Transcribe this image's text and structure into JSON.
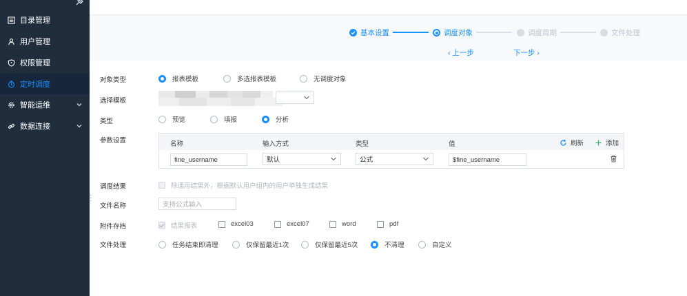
{
  "sidebar": {
    "items": [
      {
        "label": "目录管理",
        "icon": "list-icon"
      },
      {
        "label": "用户管理",
        "icon": "user-icon"
      },
      {
        "label": "权限管理",
        "icon": "shield-icon"
      },
      {
        "label": "定时调度",
        "icon": "clock-icon"
      },
      {
        "label": "智能运维",
        "icon": "gear-icon"
      },
      {
        "label": "数据连接",
        "icon": "link-icon"
      }
    ]
  },
  "steps": [
    {
      "label": "基本设置",
      "state": "done"
    },
    {
      "label": "调度对象",
      "state": "current"
    },
    {
      "label": "调度周期",
      "state": "todo"
    },
    {
      "label": "文件处理",
      "state": "todo"
    }
  ],
  "nav": {
    "prev": "上一步",
    "next": "下一步"
  },
  "form": {
    "object_type": {
      "label": "对象类型",
      "options": [
        "报表模板",
        "多选报表模板",
        "无调度对象"
      ],
      "selected": "报表模板"
    },
    "template": {
      "label": "选择模板"
    },
    "type": {
      "label": "类型",
      "options": [
        "预览",
        "填报",
        "分析"
      ],
      "selected": "分析"
    },
    "params": {
      "label": "参数设置",
      "headers": [
        "名称",
        "输入方式",
        "类型",
        "值"
      ],
      "refresh": "刷新",
      "add": "添加",
      "rows": [
        {
          "name": "fine_username",
          "input_mode": "默认",
          "type": "公式",
          "value": "$fine_username"
        }
      ]
    },
    "result": {
      "label": "调度结果",
      "option": "除通用结果外，根据默认用户组内的用户单独生成结果"
    },
    "filename": {
      "label": "文件名称",
      "placeholder": "支持公式输入"
    },
    "attachment": {
      "label": "附件存档",
      "options": [
        "结果报表",
        "excel03",
        "excel07",
        "word",
        "pdf"
      ],
      "checked": [
        "结果报表"
      ]
    },
    "file_handling": {
      "label": "文件处理",
      "options": [
        "任务结束即清理",
        "仅保留最近1次",
        "仅保留最近5次",
        "不清理",
        "自定义"
      ],
      "selected": "不清理"
    }
  },
  "colors": {
    "sidebar_bg": "#1f2d3d",
    "accent": "#1890ff",
    "inactive": "#c0c4cc"
  }
}
